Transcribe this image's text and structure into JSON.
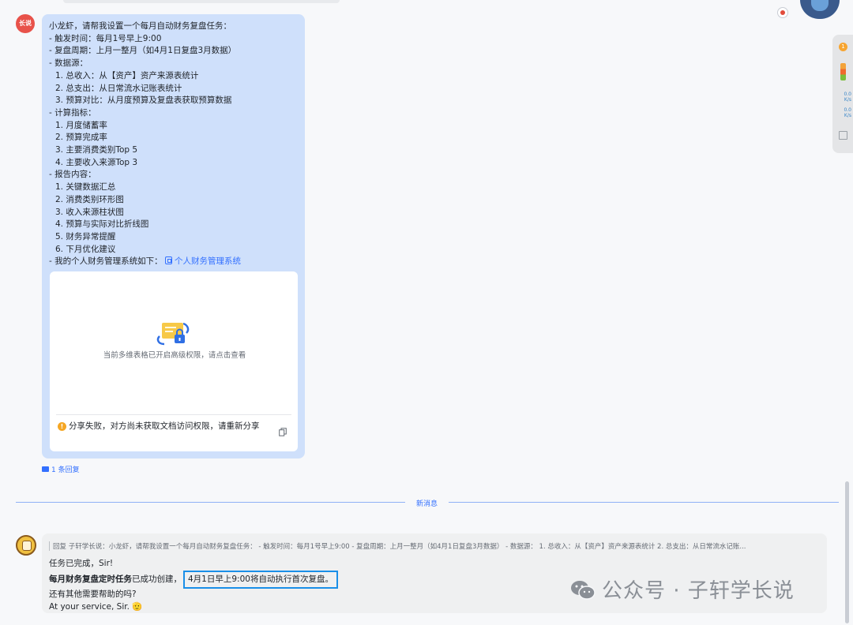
{
  "question": {
    "avatar_label": "长说",
    "lines": [
      "小龙虾，请帮我设置一个每月自动财务复盘任务：",
      "- 触发时间：每月1号早上9:00",
      "- 复盘周期：上月一整月（如4月1日复盘3月数据）",
      "- 数据源：",
      "1. 总收入：从【资产】资产来源表统计",
      "2. 总支出：从日常流水记账表统计",
      "3. 预算对比：从月度预算及复盘表获取预算数据",
      "- 计算指标：",
      "1. 月度储蓄率",
      "2. 预算完成率",
      "3. 主要消费类别Top 5",
      "4. 主要收入来源Top 3",
      "- 报告内容：",
      "1. 关键数据汇总",
      "2. 消费类别环形图",
      "3. 收入来源柱状图",
      "4. 预算与实际对比折线图",
      "5. 财务异常提醒",
      "6. 下月优化建议"
    ],
    "link_prefix": "- 我的个人财务管理系统如下：",
    "link_text": "个人财务管理系统",
    "card_message": "当前多维表格已开启高级权限，请点击查看",
    "card_warning": "分享失败，对方尚未获取文档访问权限，请重新分享",
    "reply_count": "1 条回复"
  },
  "divider": {
    "label": "新消息"
  },
  "answer": {
    "quote": "回复 子轩学长说：小龙虾，请帮我设置一个每月自动财务复盘任务： - 触发时间：每月1号早上9:00 - 复盘周期：上月一整月（如4月1日复盘3月数据） - 数据源： 1. 总收入：从【资产】资产来源表统计 2. 总支出：从日常流水记账...",
    "line1": "任务已完成，Sir!",
    "line2_bold": "每月财务复盘定时任务",
    "line2_plain": "已成功创建，",
    "line2_highlight": "4月1日早上9:00将自动执行首次复盘。",
    "line3": "还有其他需要帮助的吗?",
    "line4": "At your service, Sir. 🫡"
  },
  "watermark": "公众号 · 子轩学长说",
  "widget": {
    "badge": "1",
    "speed1": "0.0",
    "unit1": "K/s",
    "speed2": "0.0",
    "unit2": "K/s"
  },
  "colors": {
    "accent": "#3370ff",
    "bubble": "#cfe0fb",
    "highlight_border": "#1a8fe8"
  }
}
